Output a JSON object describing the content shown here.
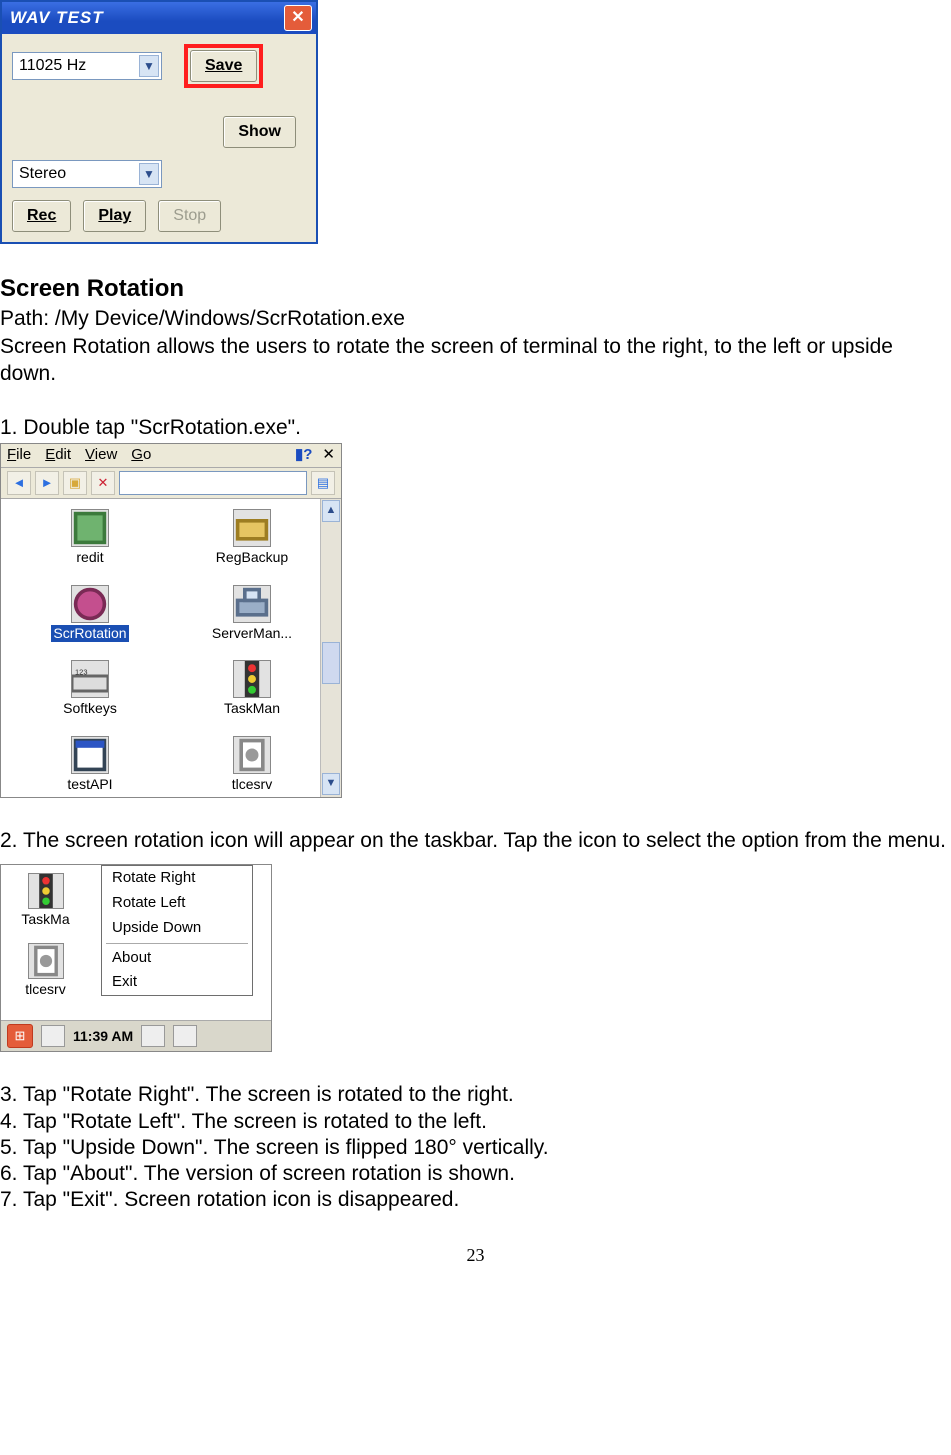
{
  "wavtest": {
    "title": "WAV TEST",
    "freq_value": "11025 Hz",
    "save_label": "Save",
    "show_label": "Show",
    "mode_value": "Stereo",
    "rec_label": "Rec",
    "play_label": "Play",
    "stop_label": "Stop"
  },
  "section": {
    "heading": "Screen Rotation",
    "path": "Path: /My Device/Windows/ScrRotation.exe",
    "desc": "Screen Rotation allows the users to rotate the screen of terminal to the right, to the left or upside down.",
    "step1": "1. Double tap \"ScrRotation.exe\".",
    "step2": "2. The screen rotation icon will appear on the taskbar. Tap the icon to select the option from the menu.",
    "step3": "3. Tap \"Rotate Right\". The screen is rotated to the right.",
    "step4": "4. Tap \"Rotate Left\". The screen is rotated to the left.",
    "step5": "5. Tap \"Upside Down\". The screen is flipped 180° vertically.",
    "step6": "6. Tap \"About\". The version of screen rotation is shown.",
    "step7": "7. Tap \"Exit\". Screen rotation icon is disappeared."
  },
  "explorer": {
    "menus": {
      "file": "File",
      "edit": "Edit",
      "view": "View",
      "go": "Go"
    },
    "icons": {
      "redit": "redit",
      "regbackup": "RegBackup",
      "scrrotation": "ScrRotation",
      "serverman": "ServerMan...",
      "softkeys": "Softkeys",
      "taskman": "TaskMan",
      "testapi": "testAPI",
      "tlcesrv": "tlcesrv"
    }
  },
  "taskmenu": {
    "icons": {
      "taskma": "TaskMa",
      "tlcesrv": "tlcesrv"
    },
    "menu": {
      "rotate_right": "Rotate Right",
      "rotate_left": "Rotate Left",
      "upside_down": "Upside Down",
      "about": "About",
      "exit": "Exit"
    },
    "clock": "11:39 AM"
  },
  "page_number": "23"
}
